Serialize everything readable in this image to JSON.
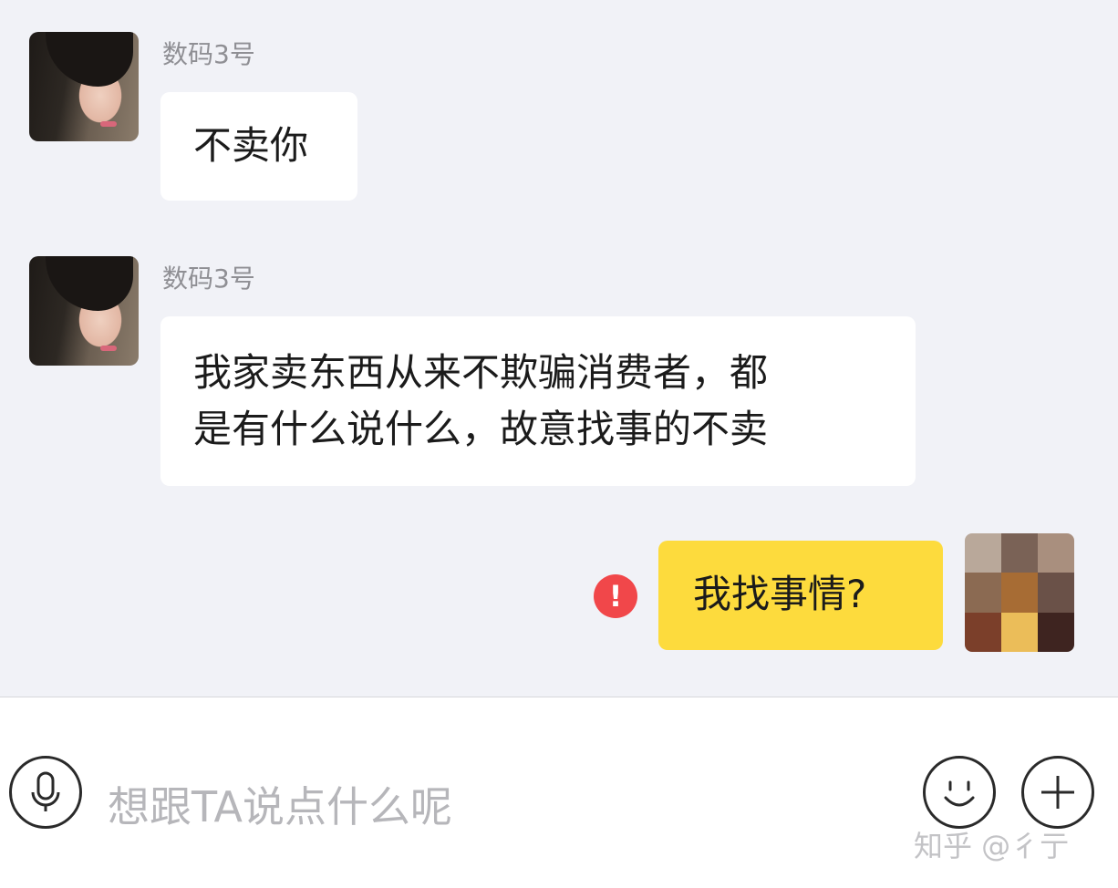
{
  "messages": [
    {
      "sender": "数码3号",
      "text": "不卖你"
    },
    {
      "sender": "数码3号",
      "lines": [
        "我家卖东西从来不欺骗消费者，都",
        "是有什么说什么，故意找事的不卖"
      ]
    },
    {
      "sender": "me",
      "text": "我找事情?",
      "status": "send-failed",
      "status_glyph": "!"
    }
  ],
  "input": {
    "placeholder": "想跟TA说点什么呢",
    "voice_icon": "microphone-icon",
    "emoji_icon": "smiley-icon",
    "more_icon": "plus-icon"
  },
  "watermark": "知乎 @彳亍",
  "colors": {
    "chat_bg": "#f1f2f7",
    "incoming_bubble": "#ffffff",
    "outgoing_bubble": "#fddb3d",
    "error_badge": "#f1474a",
    "name_text": "#8f8f94",
    "placeholder_text": "#b6b6ba"
  }
}
